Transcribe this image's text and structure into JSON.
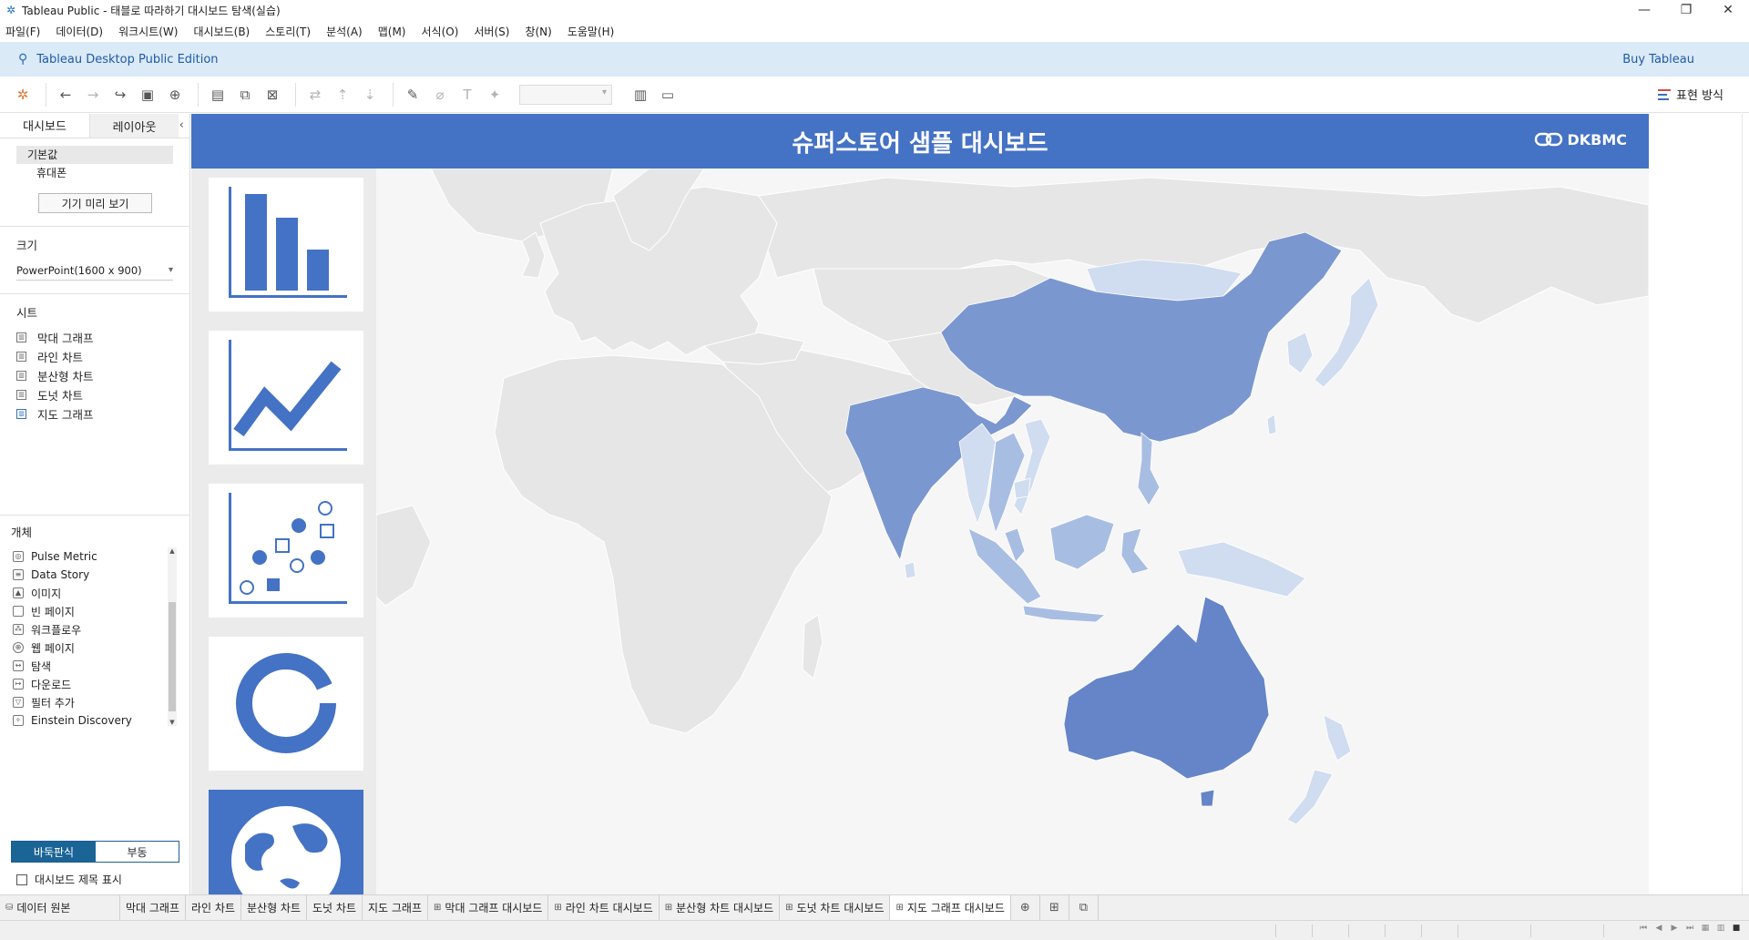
{
  "window": {
    "title": "Tableau Public - 태블로 따라하기 대시보드 탐색(실습)"
  },
  "menu": [
    "파일(F)",
    "데이터(D)",
    "워크시트(W)",
    "대시보드(B)",
    "스토리(T)",
    "분석(A)",
    "맵(M)",
    "서식(O)",
    "서버(S)",
    "창(N)",
    "도움말(H)"
  ],
  "brand": {
    "edition": "Tableau Desktop Public Edition",
    "buy": "Buy Tableau"
  },
  "toolbar": {
    "show_me": "표현 방식"
  },
  "left_panel": {
    "tabs": [
      "대시보드",
      "레이아웃"
    ],
    "devices": [
      "기본값",
      "휴대폰"
    ],
    "device_preview": "기기 미리 보기",
    "size_title": "크기",
    "size_value": "PowerPoint(1600 x 900)",
    "sheets_title": "시트",
    "sheets": [
      "막대 그래프",
      "라인 차트",
      "분산형 차트",
      "도넛 차트",
      "지도 그래프"
    ],
    "objects_title": "개체",
    "objects": [
      "Pulse Metric",
      "Data Story",
      "이미지",
      "빈 페이지",
      "워크플로우",
      "웹 페이지",
      "탐색",
      "다운로드",
      "필터 추가",
      "Einstein Discovery"
    ],
    "tiled": "바둑판식",
    "floating": "부동",
    "show_title": "대시보드 제목 표시"
  },
  "dashboard": {
    "title": "슈퍼스토어 샘플 대시보드",
    "logo": "DKBMC",
    "accent": "#4472c4",
    "highlighted_countries": [
      "China",
      "India",
      "Australia",
      "Indonesia",
      "Japan",
      "Philippines",
      "Vietnam",
      "Thailand",
      "Malaysia",
      "Papua New Guinea",
      "New Zealand",
      "Myanmar",
      "Bangladesh",
      "Sri Lanka",
      "Cambodia",
      "Mongolia"
    ]
  },
  "tabs": [
    {
      "label": "데이터 원본",
      "icon": "datasource-icon"
    },
    {
      "label": "막대 그래프",
      "icon": ""
    },
    {
      "label": "라인 차트",
      "icon": ""
    },
    {
      "label": "분산형 차트",
      "icon": ""
    },
    {
      "label": "도넛 차트",
      "icon": ""
    },
    {
      "label": "지도 그래프",
      "icon": ""
    },
    {
      "label": "막대 그래프 대시보드",
      "icon": "dashboard-icon"
    },
    {
      "label": "라인 차트 대시보드",
      "icon": "dashboard-icon"
    },
    {
      "label": "분산형 차트 대시보드",
      "icon": "dashboard-icon"
    },
    {
      "label": "도넛 차트 대시보드",
      "icon": "dashboard-icon"
    },
    {
      "label": "지도 그래프 대시보드",
      "icon": "dashboard-icon",
      "active": true
    }
  ]
}
